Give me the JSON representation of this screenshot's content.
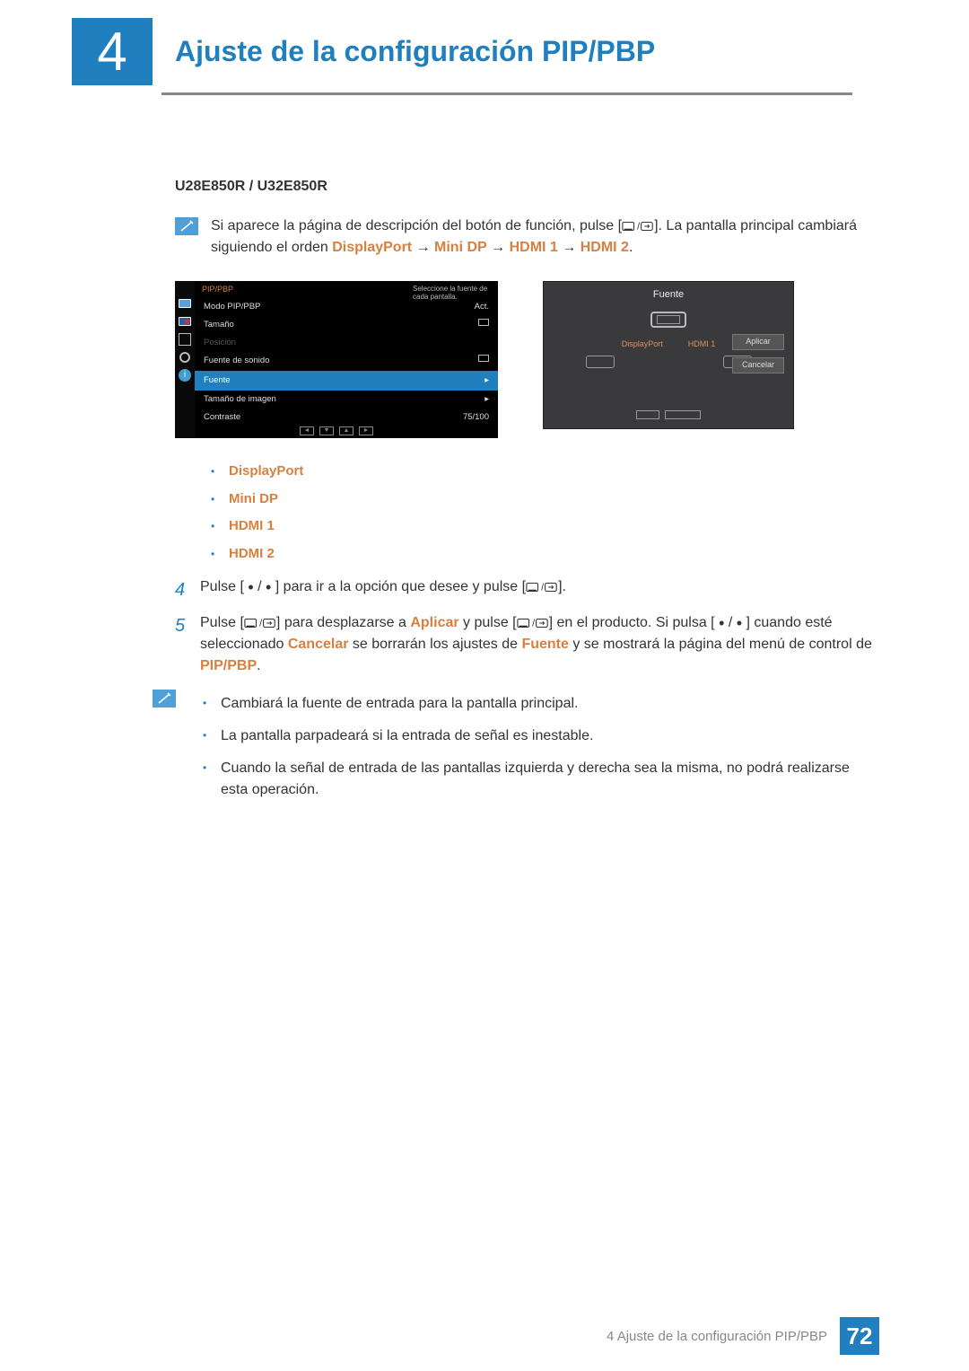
{
  "header": {
    "chapter_number": "4",
    "chapter_title": "Ajuste de la configuración PIP/PBP"
  },
  "model_heading": "U28E850R / U32E850R",
  "note1": {
    "prefix": "Si aparece la página de descripción del botón de función, pulse [",
    "mid": "]. La pantalla principal cambiará siguiendo el orden ",
    "seq": {
      "a": "DisplayPort",
      "b": "Mini DP",
      "c": "HDMI 1",
      "d": "HDMI 2"
    },
    "arrow": " → "
  },
  "osd_menu": {
    "title": "PIP/PBP",
    "hint": "Seleccione la fuente de cada pantalla.",
    "items": {
      "modo": {
        "label": "Modo PIP/PBP",
        "value": "Act."
      },
      "tamano": {
        "label": "Tamaño",
        "value": ""
      },
      "posicion": {
        "label": "Posición",
        "value": ""
      },
      "fuente_sonido": {
        "label": "Fuente de sonido",
        "value": ""
      },
      "fuente": {
        "label": "Fuente",
        "value": ""
      },
      "tamano_imagen": {
        "label": "Tamaño de imagen",
        "value": ""
      },
      "contraste": {
        "label": "Contraste",
        "value": "75/100"
      }
    }
  },
  "src_dialog": {
    "title": "Fuente",
    "labels": {
      "dp": "DisplayPort",
      "hdmi1": "HDMI 1"
    },
    "buttons": {
      "apply": "Aplicar",
      "cancel": "Cancelar"
    }
  },
  "sources_list": [
    "DisplayPort",
    "Mini DP",
    "HDMI 1",
    "HDMI 2"
  ],
  "step4": {
    "num": "4",
    "t1": "Pulse [ ",
    "dot": "•",
    "slash": " / ",
    "t2": " ] para ir a la opción que desee y pulse [",
    "t3": "]."
  },
  "step5": {
    "num": "5",
    "t1": "Pulse [",
    "t2": "] para desplazarse a ",
    "aplicar": "Aplicar",
    "t3": " y pulse [",
    "t4": "] en el producto. Si pulsa [ ",
    "t5": " ] cuando esté seleccionado ",
    "cancelar": "Cancelar",
    "t6": " se borrarán los ajustes de ",
    "fuente": "Fuente",
    "t7": " y se mostrará la página del menú de control de ",
    "pippbp": "PIP/PBP",
    "t8": "."
  },
  "info_notes": [
    "Cambiará la fuente de entrada para la pantalla principal.",
    "La pantalla parpadeará si la entrada de señal es inestable.",
    "Cuando la señal de entrada de las pantallas izquierda y derecha sea la misma, no podrá realizarse esta operación."
  ],
  "footer": {
    "text": "4 Ajuste de la configuración PIP/PBP",
    "page": "72"
  }
}
